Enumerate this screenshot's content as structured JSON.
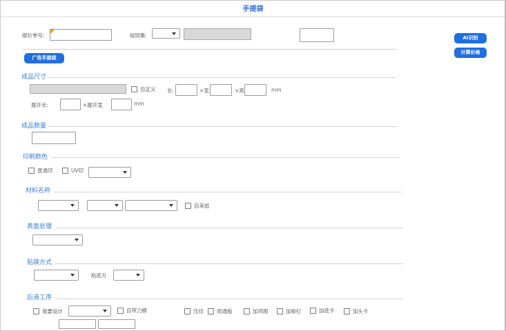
{
  "window": {
    "title": "手提袋"
  },
  "header": {
    "quote_no_label": "报价单号:",
    "rule_set_label": "规则集:"
  },
  "buttons": {
    "ai_label": "AI识别",
    "price_label": "计算价格",
    "ad_bag_label": "广告手提袋"
  },
  "size": {
    "title": "成品尺寸",
    "custom_label": "自定义",
    "length_label": "长:",
    "width_label": "×宽",
    "height_label": "×高",
    "unit": "mm",
    "unfold_length_label": "展开长:",
    "unfold_width_label": "×展开宽",
    "unfold_unit": "mm"
  },
  "quantity": {
    "title": "成品数量"
  },
  "print_color": {
    "title": "印刷颜色",
    "normal_label": "普通印",
    "uv_label": "UV印"
  },
  "material": {
    "title": "材料名称",
    "own_paper_label": "自来纸"
  },
  "surface": {
    "title": "表面处理"
  },
  "pasting": {
    "title": "贴袋方式",
    "bottom_label": "粘底方"
  },
  "post_process": {
    "title": "后道工序",
    "my_design_label": "我要设计",
    "own_die_label": "自带刀模",
    "press_line_label": "压纹",
    "universal_label": "用通版",
    "add_eyelet_label": "加鸡眼",
    "add_rivet_label": "加柳钉",
    "add_bottom_card_label": "加底卡",
    "add_head_card_label": "加头卡"
  }
}
